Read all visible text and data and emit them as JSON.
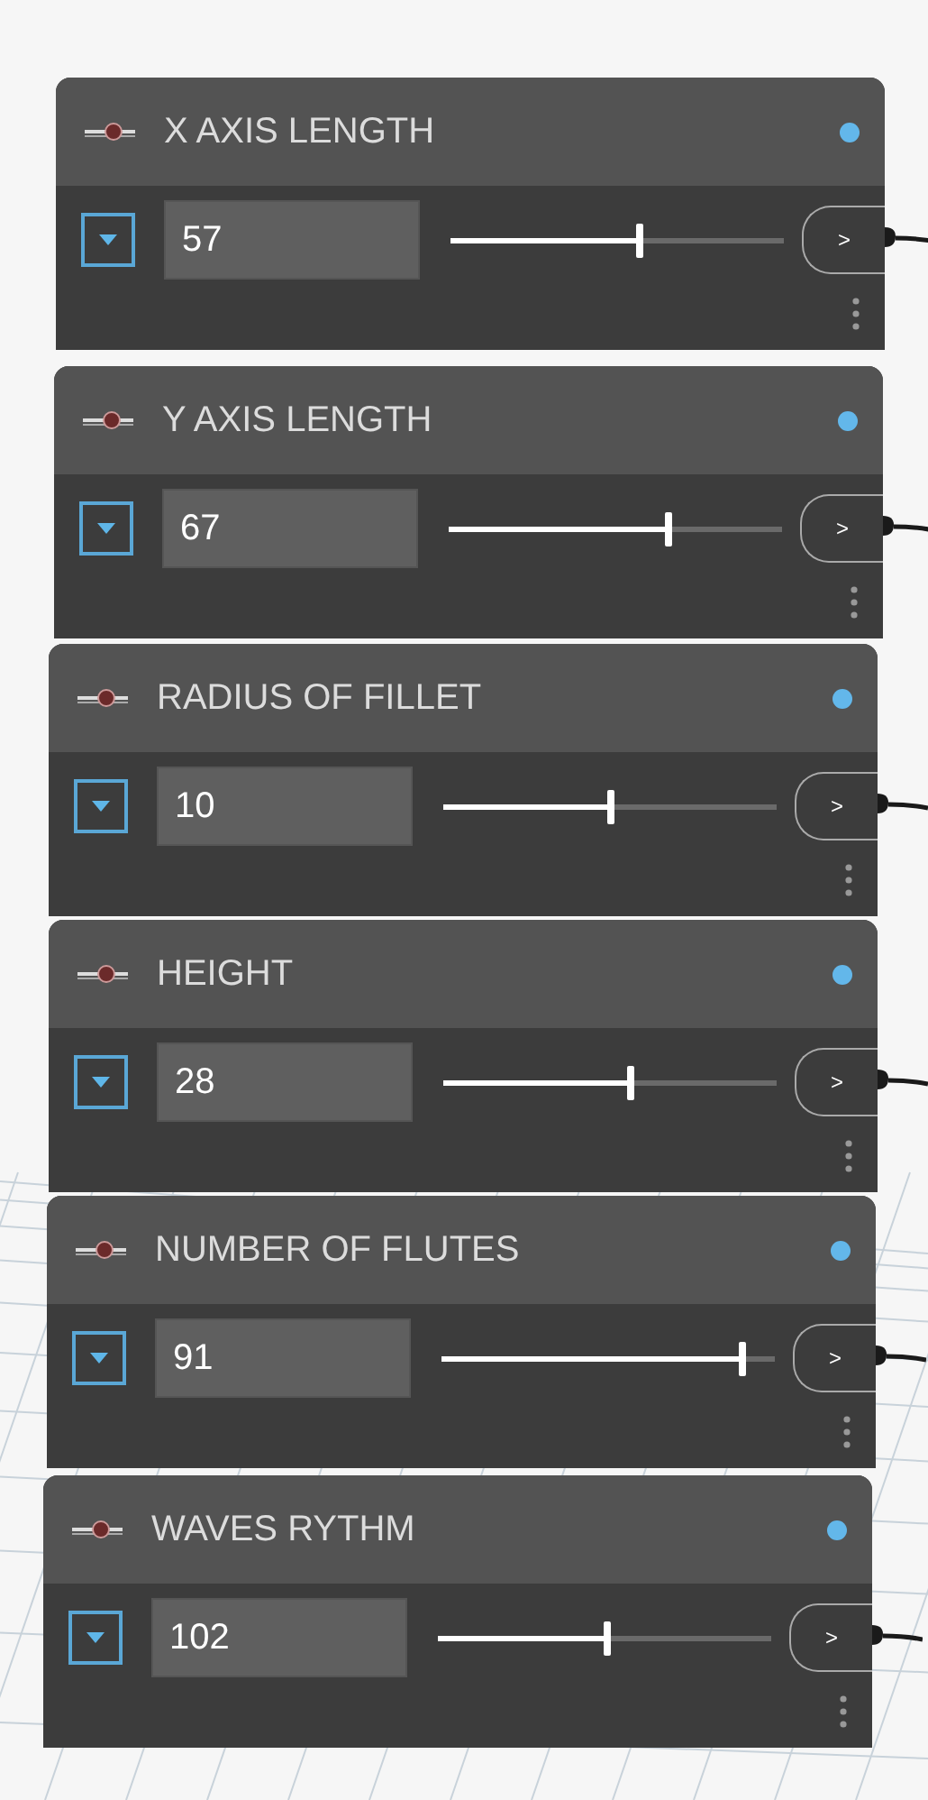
{
  "nodes": [
    {
      "title": "X AXIS LENGTH",
      "value": "57",
      "level": 0.57,
      "output_port": ">"
    },
    {
      "title": "Y AXIS LENGTH",
      "value": "67",
      "level": 0.66,
      "output_port": ">"
    },
    {
      "title": "RADIUS OF FILLET",
      "value": "10",
      "level": 0.5,
      "output_port": ">"
    },
    {
      "title": "HEIGHT",
      "value": "28",
      "level": 0.56,
      "output_port": ">"
    },
    {
      "title": "NUMBER OF FLUTES",
      "value": "91",
      "level": 0.9,
      "output_port": ">"
    },
    {
      "title": "WAVES RYTHM",
      "value": "102",
      "level": 0.51,
      "output_port": ">"
    }
  ]
}
